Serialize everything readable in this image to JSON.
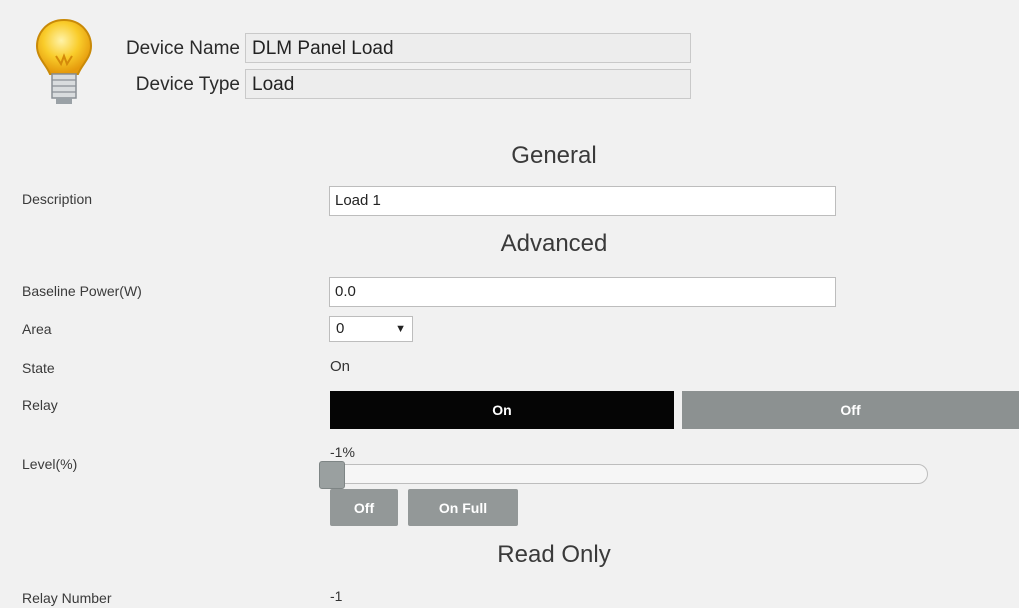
{
  "header": {
    "device_name_label": "Device Name",
    "device_name_value": "DLM Panel Load",
    "device_type_label": "Device Type",
    "device_type_value": "Load",
    "icon": "lightbulb-icon"
  },
  "sections": {
    "general": "General",
    "advanced": "Advanced",
    "read_only": "Read Only"
  },
  "general": {
    "description_label": "Description",
    "description_value": "Load 1"
  },
  "advanced": {
    "baseline_power_label": "Baseline Power(W)",
    "baseline_power_value": "0.0",
    "area_label": "Area",
    "area_value": "0",
    "state_label": "State",
    "state_value": "On",
    "relay_label": "Relay",
    "relay_on_label": "On",
    "relay_off_label": "Off",
    "relay_selected": "On",
    "level_label": "Level(%)",
    "level_value_text": "-1%",
    "level_value": -1,
    "level_off_button": "Off",
    "level_on_full_button": "On Full"
  },
  "read_only": {
    "relay_number_label": "Relay Number",
    "relay_number_value": "-1"
  },
  "colors": {
    "background": "#f1f1f1",
    "relay_on_bg": "#050505",
    "relay_off_bg": "#8c9191",
    "button_gray": "#939898",
    "bulb_yellow": "#f7c21b"
  }
}
